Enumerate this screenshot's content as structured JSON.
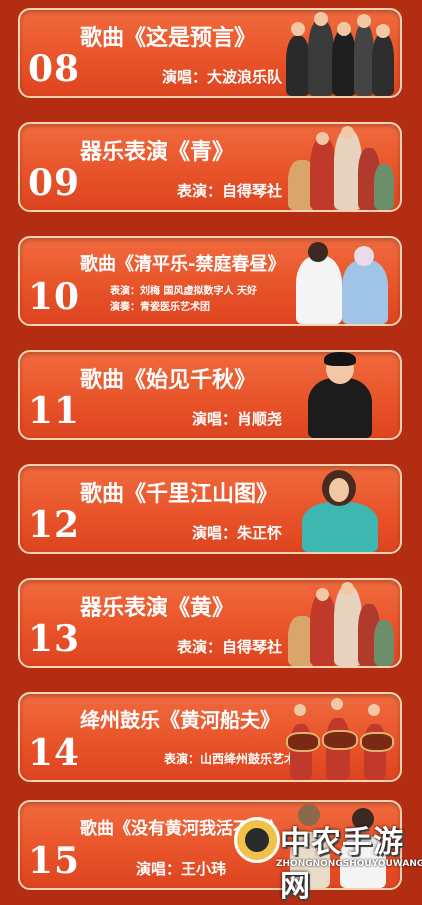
{
  "programs": [
    {
      "num": "08",
      "title": "歌曲《这是预言》",
      "meta": "演唱：大波浪乐队"
    },
    {
      "num": "09",
      "title": "器乐表演《青》",
      "meta": "表演：自得琴社"
    },
    {
      "num": "10",
      "title": "歌曲《清平乐-禁庭春昼》",
      "meta_line1": "表演：刘梅  国风虚拟数字人 天好",
      "meta_line2": "演奏：青瓷医乐艺术团"
    },
    {
      "num": "11",
      "title": "歌曲《始见千秋》",
      "meta": "演唱：肖顺尧"
    },
    {
      "num": "12",
      "title": "歌曲《千里江山图》",
      "meta": "演唱：朱正怀"
    },
    {
      "num": "13",
      "title": "器乐表演《黄》",
      "meta": "表演：自得琴社"
    },
    {
      "num": "14",
      "title": "绛州鼓乐《黄河船夫》",
      "meta": "表演：山西绛州鼓乐艺术团"
    },
    {
      "num": "15",
      "title": "歌曲《没有黄河我活不下》",
      "meta": "演唱：王小玮"
    }
  ],
  "watermark": {
    "text": "中农手游网",
    "sub": "ZHONGNONGSHOUYOUWANG"
  },
  "colors": {
    "background": "#b32d12",
    "card": "#e9542a",
    "card_border": "#f7d2b2"
  }
}
